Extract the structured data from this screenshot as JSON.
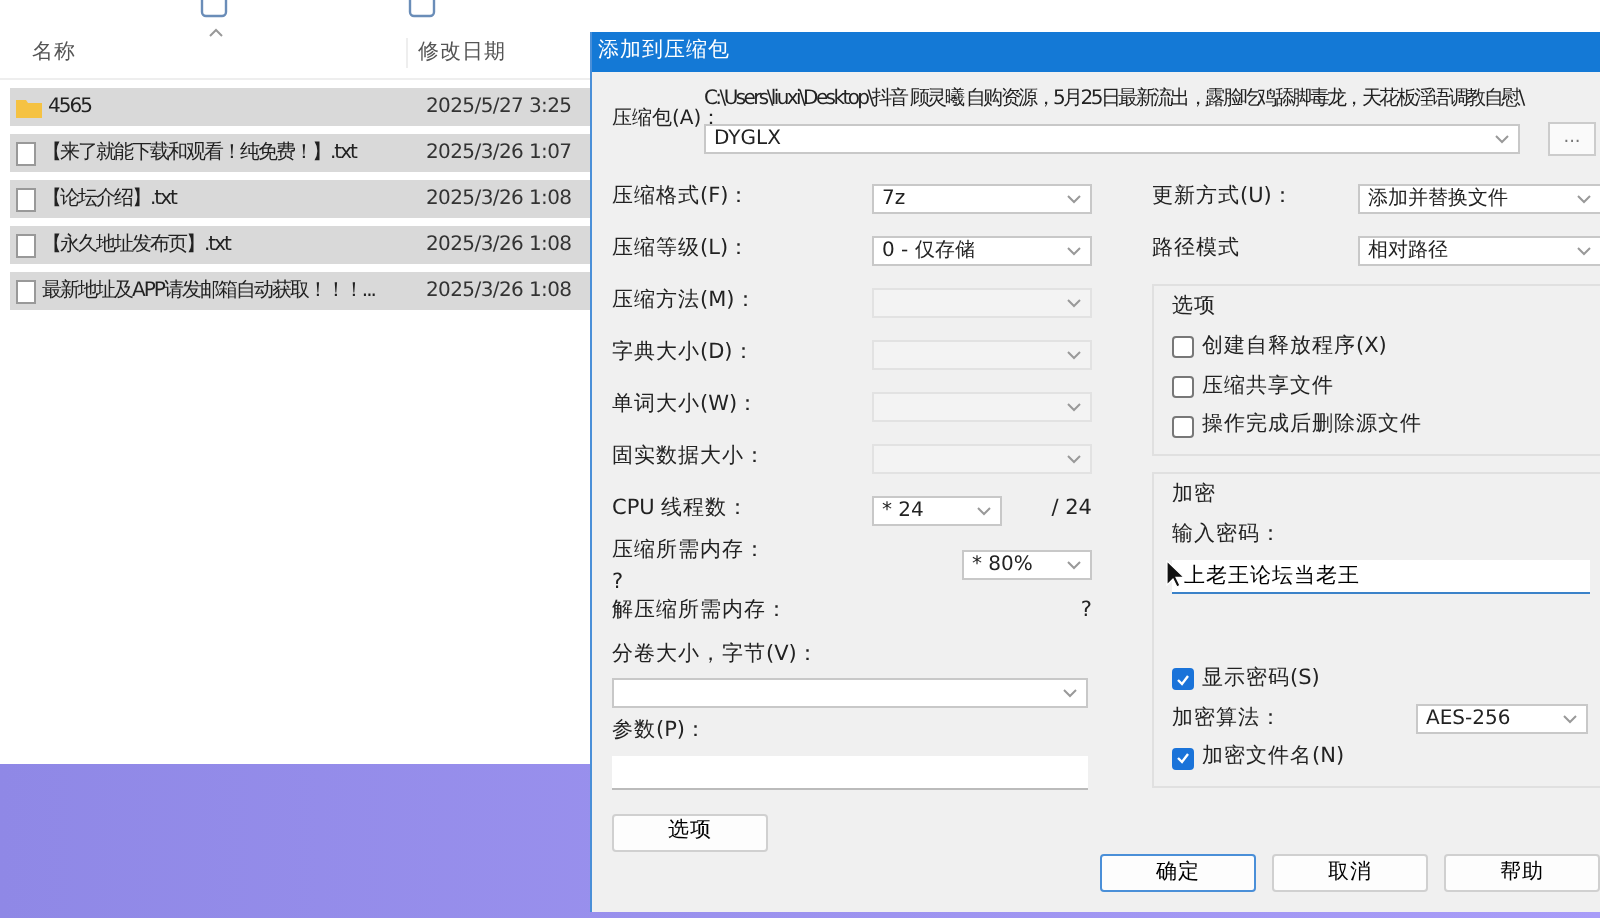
{
  "explorer": {
    "columns": [
      "名称",
      "修改日期"
    ],
    "rows": [
      {
        "kind": "folder",
        "name": "4565",
        "date": "2025/5/27 3:25",
        "selected": true
      },
      {
        "kind": "file",
        "name": "【来了就能下载和观看！纯免费！】.txt",
        "date": "2025/3/26 1:07",
        "selected": true
      },
      {
        "kind": "file",
        "name": "【论坛介绍】.txt",
        "date": "2025/3/26 1:08",
        "selected": true
      },
      {
        "kind": "file",
        "name": "【永久地址发布页】.txt",
        "date": "2025/3/26 1:08",
        "selected": true
      },
      {
        "kind": "file",
        "name": "最新地址及APP请发邮箱自动获取！！！...",
        "date": "2025/3/26 1:08",
        "selected": true
      }
    ]
  },
  "dialog": {
    "title": "添加到压缩包",
    "archive": {
      "label": "压缩包(A)：",
      "path": "C:\\Users\\liuxi\\Desktop\\抖音 顾灵曦 自购资源，5月25日最新流出，露脸吃鸡舔脚毒龙，天花板淫语调教自慰\\",
      "value": "DYGLX",
      "browse": "..."
    },
    "fields": [
      {
        "label": "压缩格式(F)：",
        "value": "7z",
        "disabled": false
      },
      {
        "label": "压缩等级(L)：",
        "value": "0 - 仅存储",
        "disabled": false
      },
      {
        "label": "压缩方法(M)：",
        "disabled": true
      },
      {
        "label": "字典大小(D)：",
        "disabled": true
      },
      {
        "label": "单词大小(W)：",
        "disabled": true
      },
      {
        "label": "固实数据大小：",
        "disabled": true
      }
    ],
    "cpu": {
      "label": "CPU 线程数：",
      "value": "* 24",
      "total": "/ 24"
    },
    "memory": {
      "label": "压缩所需内存：",
      "note": "?",
      "value": "* 80%"
    },
    "decompress_memory": {
      "label": "解压缩所需内存：",
      "value": "?"
    },
    "volume": {
      "label": "分卷大小，字节(V)："
    },
    "params": {
      "label": "参数(P)："
    },
    "options_button": "选项",
    "update_mode": {
      "label": "更新方式(U)：",
      "value": "添加并替换文件"
    },
    "path_mode": {
      "label": "路径模式",
      "value": "相对路径"
    },
    "options": {
      "title": "选项",
      "checkboxes": [
        {
          "label": "创建自释放程序(X)",
          "checked": false
        },
        {
          "label": "压缩共享文件",
          "checked": false
        },
        {
          "label": "操作完成后删除源文件",
          "checked": false
        }
      ]
    },
    "encryption": {
      "title": "加密",
      "password_label": "输入密码：",
      "password": "上老王论坛当老王",
      "show_password": {
        "label": "显示密码(S)",
        "checked": true
      },
      "method_label": "加密算法：",
      "method": "AES-256",
      "encrypt_names": {
        "label": "加密文件名(N)",
        "checked": true
      }
    },
    "buttons": [
      {
        "label": "确定",
        "focused": true
      },
      {
        "label": "取消",
        "focused": false
      },
      {
        "label": "帮助",
        "focused": false
      }
    ]
  }
}
